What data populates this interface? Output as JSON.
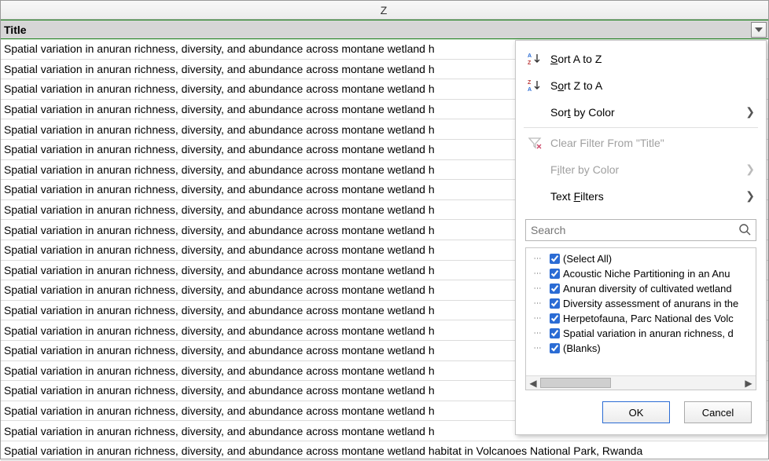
{
  "columnLetter": "Z",
  "columnHeader": "Title",
  "cellText": "Spatial variation in anuran richness, diversity, and abundance across montane wetland h",
  "cellTextFull": "Spatial variation in anuran richness, diversity, and abundance across montane wetland habitat in Volcanoes National Park, Rwanda",
  "rowCount": 21,
  "filterMenu": {
    "sortAZ": "Sort A to Z",
    "sortZA": "Sort Z to A",
    "sortByColor": "Sort by Color",
    "clearFilter": "Clear Filter From \"Title\"",
    "filterByColor": "Filter by Color",
    "textFilters": "Text Filters",
    "searchPlaceholder": "Search",
    "checkItems": [
      "(Select All)",
      "Acoustic Niche Partitioning in an Anu",
      "Anuran diversity of cultivated wetland",
      "Diversity assessment of anurans in the",
      "Herpetofauna, Parc National des Volc",
      "Spatial variation in anuran richness, d",
      "(Blanks)"
    ],
    "ok": "OK",
    "cancel": "Cancel"
  }
}
